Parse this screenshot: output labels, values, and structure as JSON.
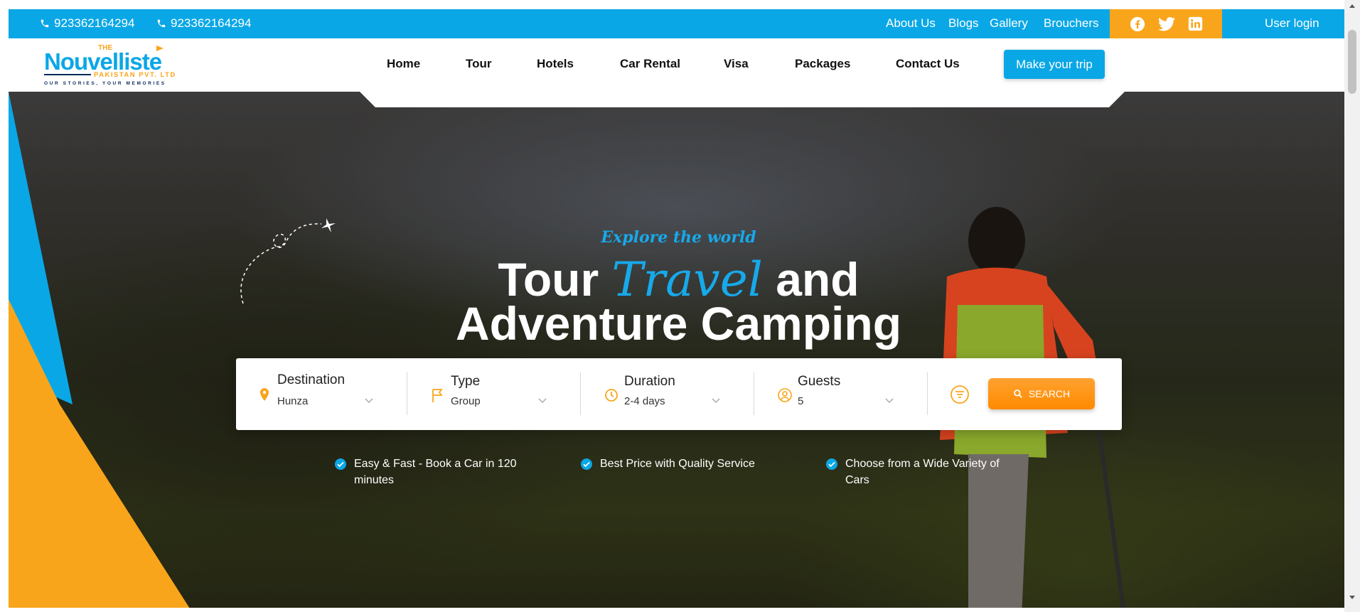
{
  "topbar": {
    "phone_1": "923362164294",
    "phone_2": "923362164294",
    "links": [
      "About Us",
      "Blogs",
      "Gallery",
      "Brouchers"
    ],
    "social_icons": [
      "facebook-icon",
      "twitter-icon",
      "linkedin-icon"
    ],
    "user_login": "User login"
  },
  "brand": {
    "logo_the": "THE",
    "logo_name": "Nouvelliste",
    "logo_sub": "PAKISTAN PVT. LTD",
    "logo_tagline": "OUR STORIES, YOUR MEMORIES"
  },
  "nav": {
    "items": [
      "Home",
      "Tour",
      "Hotels",
      "Car Rental",
      "Visa",
      "Packages",
      "Contact Us"
    ],
    "cta": "Make your trip"
  },
  "hero": {
    "kicker": "Explore the world",
    "title_part1": "Tour ",
    "title_accent": "Travel",
    "title_part2": " and",
    "title_line2": "Adventure Camping"
  },
  "search": {
    "fields": [
      {
        "label": "Destination",
        "value": "Hunza",
        "icon": "location-pin-icon"
      },
      {
        "label": "Type",
        "value": "Group",
        "icon": "flag-icon"
      },
      {
        "label": "Duration",
        "value": "2-4 days",
        "icon": "clock-icon"
      },
      {
        "label": "Guests",
        "value": "5",
        "icon": "user-icon"
      }
    ],
    "button": "SEARCH"
  },
  "features": [
    "Easy & Fast - Book a Car in 120 minutes",
    "Best Price with Quality Service",
    "Choose from a Wide Variety of Cars"
  ],
  "colors": {
    "primary": "#0aa7e6",
    "accent": "#f9a51b",
    "search_button": "#ff8a00"
  }
}
